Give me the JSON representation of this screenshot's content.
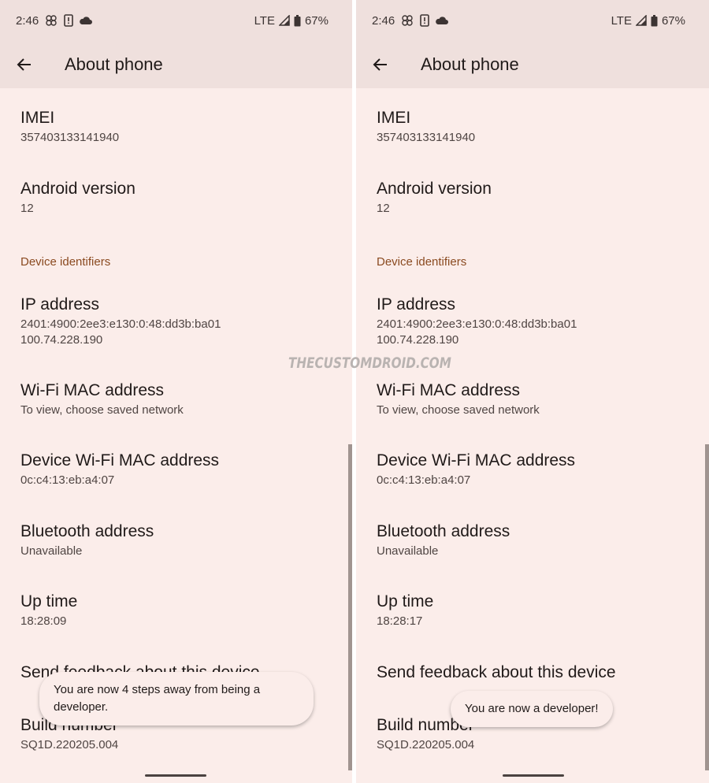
{
  "watermark": "THECUSTOMDROID.COM",
  "colors": {
    "appbar_bg": "#efe0dd",
    "content_bg": "#fbedea",
    "section_header": "#8a4a20",
    "primary_text": "#201a19",
    "secondary_text": "#4f4543"
  },
  "screens": [
    {
      "status_bar": {
        "time": "2:46",
        "left_icons": [
          "fan-icon",
          "phone-alert-icon",
          "cloud-icon"
        ],
        "network": "LTE",
        "battery": "67%"
      },
      "toolbar": {
        "back_icon": "arrow-back-icon",
        "title": "About phone"
      },
      "items": [
        {
          "title": "IMEI",
          "summary": "357403133141940"
        },
        {
          "title": "Android version",
          "summary": "12"
        },
        {
          "title": "IP address",
          "summary": "2401:4900:2ee3:e130:0:48:dd3b:ba01",
          "summary2": "100.74.228.190"
        },
        {
          "title": "Wi-Fi MAC address",
          "summary": "To view, choose saved network"
        },
        {
          "title": "Device Wi-Fi MAC address",
          "summary": "0c:c4:13:eb:a4:07"
        },
        {
          "title": "Bluetooth address",
          "summary": "Unavailable"
        },
        {
          "title": "Up time",
          "summary": "18:28:09"
        },
        {
          "title": "Send feedback about this device"
        },
        {
          "title": "Build number",
          "summary": "SQ1D.220205.004"
        }
      ],
      "section_header": "Device identifiers",
      "toast": "You are now 4 steps away from being a developer."
    },
    {
      "status_bar": {
        "time": "2:46",
        "left_icons": [
          "fan-icon",
          "phone-alert-icon",
          "cloud-icon"
        ],
        "network": "LTE",
        "battery": "67%"
      },
      "toolbar": {
        "back_icon": "arrow-back-icon",
        "title": "About phone"
      },
      "items": [
        {
          "title": "IMEI",
          "summary": "357403133141940"
        },
        {
          "title": "Android version",
          "summary": "12"
        },
        {
          "title": "IP address",
          "summary": "2401:4900:2ee3:e130:0:48:dd3b:ba01",
          "summary2": "100.74.228.190"
        },
        {
          "title": "Wi-Fi MAC address",
          "summary": "To view, choose saved network"
        },
        {
          "title": "Device Wi-Fi MAC address",
          "summary": "0c:c4:13:eb:a4:07"
        },
        {
          "title": "Bluetooth address",
          "summary": "Unavailable"
        },
        {
          "title": "Up time",
          "summary": "18:28:17"
        },
        {
          "title": "Send feedback about this device"
        },
        {
          "title": "Build number",
          "summary": "SQ1D.220205.004"
        }
      ],
      "section_header": "Device identifiers",
      "toast": "You are now a developer!"
    }
  ]
}
